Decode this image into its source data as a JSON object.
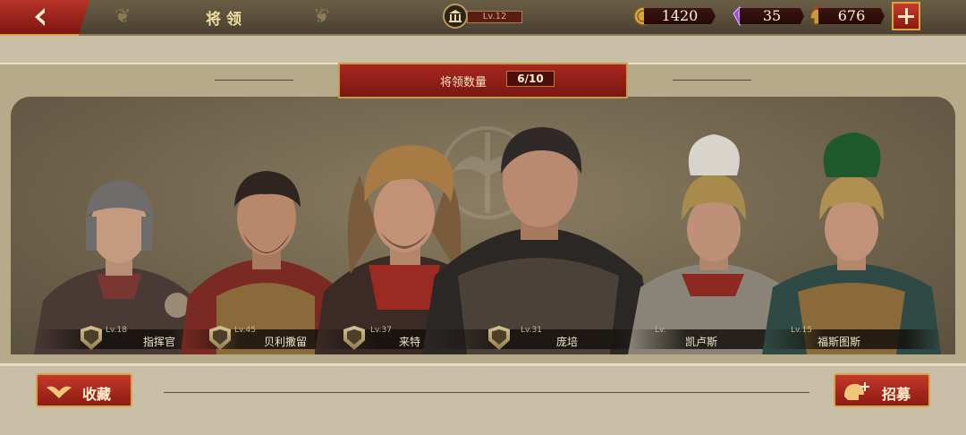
{
  "topbar": {
    "title": "将领",
    "city_level": "Lv.12",
    "resources": [
      {
        "icon": "gold-coin-icon",
        "value": "1420"
      },
      {
        "icon": "purple-gem-icon",
        "value": "35"
      },
      {
        "icon": "legion-helmet-icon",
        "value": "676"
      }
    ]
  },
  "panel": {
    "count_label": "将领数量",
    "count_value": "6/10"
  },
  "generals": [
    {
      "name": "指挥官",
      "level": "Lv.18"
    },
    {
      "name": "贝利撒留",
      "level": "Lv.45"
    },
    {
      "name": "来特",
      "level": "Lv.37"
    },
    {
      "name": "庞培",
      "level": "Lv.31"
    },
    {
      "name": "凯卢斯",
      "level": "Lv."
    },
    {
      "name": "福斯图斯",
      "level": "Lv.15"
    }
  ],
  "bottom": {
    "collect_label": "收藏",
    "recruit_label": "招募"
  },
  "colors": {
    "accent_red": "#b0291f",
    "gold_trim": "#d9a441",
    "panel": "#b6aa8a"
  }
}
